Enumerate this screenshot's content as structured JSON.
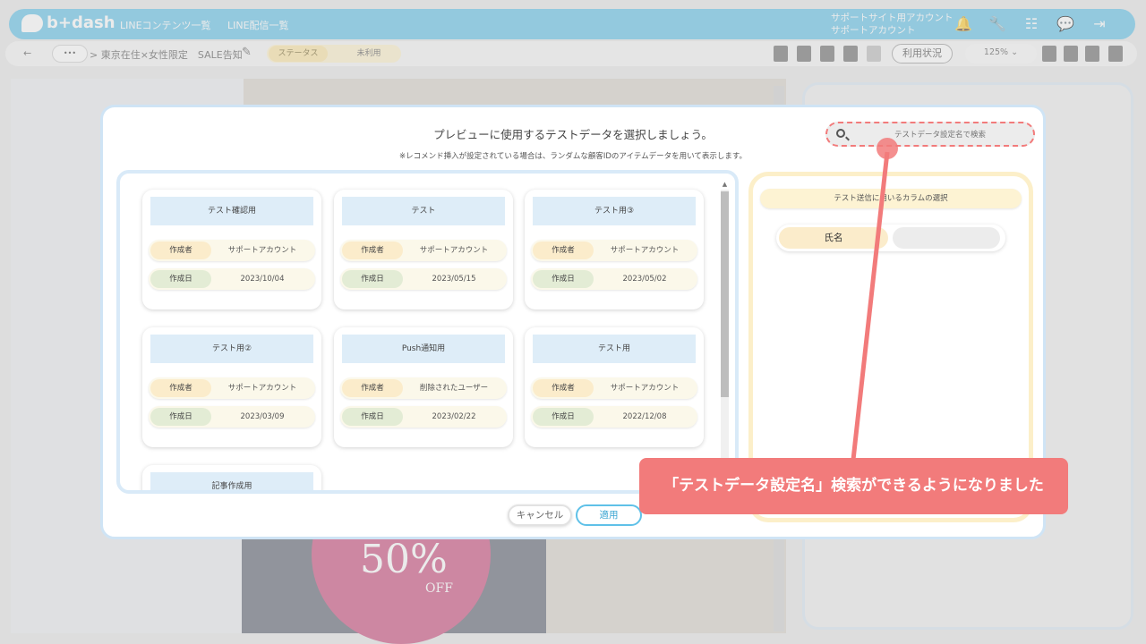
{
  "app": {
    "logo_text": "b+dash",
    "nav": [
      "LINEコンテンツ一覧",
      "LINE配信一覧"
    ],
    "account_line1": "サポートサイト用アカウント",
    "account_line2": "サポートアカウント"
  },
  "toolbar": {
    "back": "←",
    "more": "•••",
    "breadcrumb": "> 東京在住×女性限定　SALE告知",
    "status_label": "ステータス",
    "status_value": "未利用",
    "usage_button": "利用状況",
    "zoom": "125%"
  },
  "background": {
    "sale_big": "50%",
    "sale_small": "OFF"
  },
  "modal": {
    "title": "プレビューに使用するテストデータを選択しましょう。",
    "note": "※レコメンド挿入が設定されている場合は、ランダムな顧客IDのアイテムデータを用いて表示します。",
    "search_placeholder": "テストデータ設定名で検索",
    "creator_label": "作成者",
    "date_label": "作成日",
    "cards": [
      {
        "title": "テスト確認用",
        "creator": "サポートアカウント",
        "date": "2023/10/04"
      },
      {
        "title": "テスト",
        "creator": "サポートアカウント",
        "date": "2023/05/15"
      },
      {
        "title": "テスト用③",
        "creator": "サポートアカウント",
        "date": "2023/05/02"
      },
      {
        "title": "テスト用②",
        "creator": "サポートアカウント",
        "date": "2023/03/09"
      },
      {
        "title": "Push通知用",
        "creator": "削除されたユーザー",
        "date": "2023/02/22"
      },
      {
        "title": "テスト用",
        "creator": "サポートアカウント",
        "date": "2022/12/08"
      },
      {
        "title": "記事作成用",
        "creator": "",
        "date": ""
      }
    ],
    "column_header": "テスト送信に用いるカラムの選択",
    "column_item": "氏名",
    "cancel": "キャンセル",
    "apply": "適用"
  },
  "callout": {
    "text": "「テストデータ設定名」検索ができるようになりました"
  }
}
